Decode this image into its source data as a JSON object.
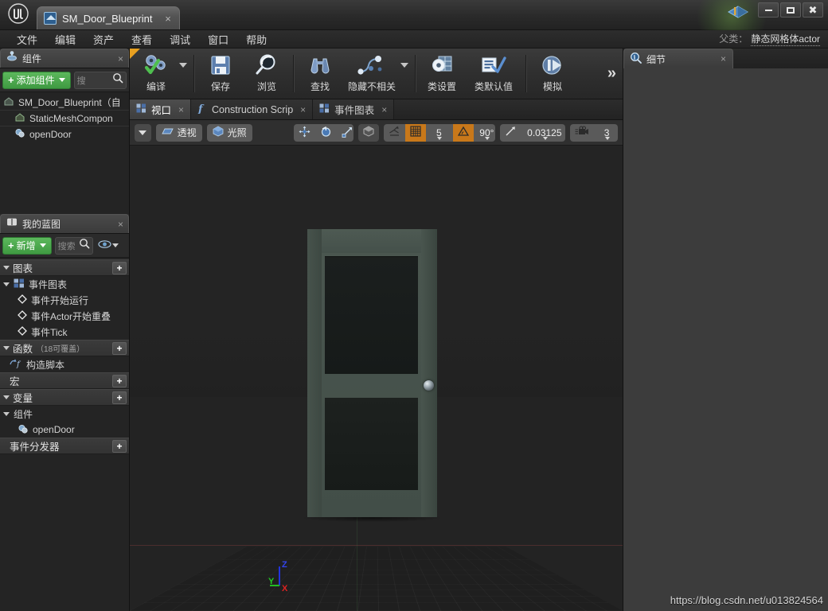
{
  "window": {
    "app_logo": "unreal-engine-logo",
    "document_tab": {
      "label": "SM_Door_Blueprint",
      "icon": "blueprint-icon",
      "close": "×"
    },
    "controls": {
      "minimize": "minimize-icon",
      "maximize": "maximize-icon",
      "close": "close-icon"
    }
  },
  "menubar": {
    "items": [
      "文件",
      "编辑",
      "资产",
      "查看",
      "调试",
      "窗口",
      "帮助"
    ],
    "parent_class_label": "父类：",
    "parent_class_value": "静态网格体actor"
  },
  "toolbar": {
    "groups": [
      {
        "buttons": [
          {
            "label": "编译",
            "icon": "compile-gears-check-icon",
            "has_dropdown": true
          }
        ]
      },
      {
        "buttons": [
          {
            "label": "保存",
            "icon": "save-floppy-icon",
            "has_dropdown": false
          },
          {
            "label": "浏览",
            "icon": "browse-magnifier-icon",
            "has_dropdown": false
          }
        ]
      },
      {
        "buttons": [
          {
            "label": "查找",
            "icon": "find-binoculars-icon",
            "has_dropdown": false
          },
          {
            "label": "隐藏不相关",
            "icon": "hide-unrelated-nodes-icon",
            "has_dropdown": true
          }
        ]
      },
      {
        "buttons": [
          {
            "label": "类设置",
            "icon": "class-settings-gear-icon",
            "has_dropdown": false
          },
          {
            "label": "类默认值",
            "icon": "class-defaults-checklist-icon",
            "has_dropdown": false
          }
        ]
      },
      {
        "buttons": [
          {
            "label": "模拟",
            "icon": "simulate-play-gear-icon",
            "has_dropdown": false
          }
        ]
      }
    ],
    "overflow": "»"
  },
  "components_panel": {
    "tab": {
      "label": "组件",
      "icon": "components-icon",
      "close": "×"
    },
    "add_button": {
      "label": "添加组件",
      "plus": "+",
      "icon": "plus-icon"
    },
    "search_placeholder": "搜索组件",
    "search_value": "搜",
    "tree": [
      {
        "label": "SM_Door_Blueprint（自",
        "icon": "blueprint-root-icon",
        "indent": 0
      },
      {
        "label": "StaticMeshCompon",
        "icon": "static-mesh-icon",
        "indent": 1
      },
      {
        "label": "openDoor",
        "icon": "timeline-icon",
        "indent": 1
      }
    ]
  },
  "myblueprint_panel": {
    "tab": {
      "label": "我的蓝图",
      "icon": "my-blueprint-book-icon",
      "close": "×"
    },
    "add_button": {
      "label": "新增",
      "plus": "+"
    },
    "search_value": "搜索",
    "sections": [
      {
        "name": "图表",
        "sub": "",
        "plus": "+",
        "expanded": true,
        "children": [
          {
            "label": "事件图表",
            "icon": "event-graph-icon",
            "indent": 1,
            "expandable": true
          },
          {
            "label": "事件开始运行",
            "icon": "event-node-icon",
            "indent": 2
          },
          {
            "label": "事件Actor开始重叠",
            "icon": "event-node-icon",
            "indent": 2
          },
          {
            "label": "事件Tick",
            "icon": "event-node-icon",
            "indent": 2
          }
        ]
      },
      {
        "name": "函数",
        "sub": "（18可覆盖）",
        "plus": "+",
        "expanded": true,
        "children": [
          {
            "label": "构造脚本",
            "icon": "function-icon",
            "indent": 1
          }
        ]
      },
      {
        "name": "宏",
        "sub": "",
        "plus": "+",
        "expanded": false,
        "children": []
      },
      {
        "name": "变量",
        "sub": "",
        "plus": "+",
        "expanded": true,
        "children": [
          {
            "label": "组件",
            "icon": "",
            "indent": 1,
            "expandable": true
          },
          {
            "label": "openDoor",
            "icon": "timeline-variable-icon",
            "indent": 2
          }
        ]
      },
      {
        "name": "事件分发器",
        "sub": "",
        "plus": "+",
        "expanded": false,
        "children": []
      }
    ]
  },
  "document_tabs": [
    {
      "label": "视口",
      "icon": "viewport-icon",
      "active": true,
      "close": "×"
    },
    {
      "label": "Construction Scrip",
      "icon": "function-f-icon",
      "active": false,
      "close": "×"
    },
    {
      "label": "事件图表",
      "icon": "event-graph-icon",
      "active": false,
      "close": "×"
    }
  ],
  "viewport_toolbar": {
    "menu_caret": "viewport-options-icon",
    "view_mode": {
      "label": "透视",
      "icon": "perspective-icon"
    },
    "lighting_mode": {
      "label": "光照",
      "icon": "lit-cube-icon"
    },
    "transform_tools": [
      "translate-gizmo-icon",
      "rotate-gizmo-icon",
      "scale-gizmo-icon"
    ],
    "coord_system": "world-space-icon",
    "surface_snap": "surface-snap-icon",
    "grid_snap": {
      "icon": "grid-snap-icon",
      "enabled": true,
      "value": "5"
    },
    "rotation_snap": {
      "icon": "angle-snap-icon",
      "enabled": true,
      "value": "90°"
    },
    "scale_snap": {
      "icon": "scale-snap-icon",
      "enabled": false,
      "value": "0.03125"
    },
    "camera_speed": {
      "icon": "camera-speed-icon",
      "value": "3"
    }
  },
  "viewport": {
    "axis_gizmo": {
      "x": "X",
      "y": "Y",
      "z": "Z",
      "x_color": "#cc2222",
      "y_color": "#22bb22",
      "z_color": "#2233dd"
    },
    "mesh_name": "door-static-mesh"
  },
  "details_panel": {
    "tab": {
      "label": "细节",
      "icon": "details-magnifier-icon",
      "close": "×"
    }
  },
  "watermark": "https://blog.csdn.net/u013824564",
  "colors": {
    "accent_orange": "#c8781a",
    "add_green": "#3f9a42",
    "panel_bg": "#242424",
    "details_bg": "#3c3c3c"
  }
}
